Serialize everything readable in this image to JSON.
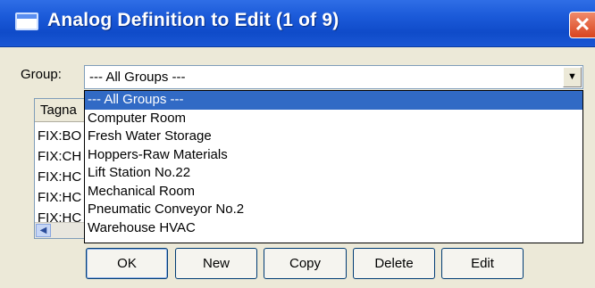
{
  "window": {
    "title": "Analog Definition to Edit (1 of 9)",
    "close_glyph": "✕"
  },
  "group": {
    "label": "Group:",
    "selected": "--- All Groups ---",
    "options": [
      "--- All Groups ---",
      "Computer Room",
      "Fresh Water Storage",
      "Hoppers-Raw Materials",
      "Lift Station No.22",
      "Mechanical Room",
      "Pneumatic Conveyor No.2",
      "Warehouse HVAC"
    ],
    "dropdown_arrow": "▼"
  },
  "list": {
    "header": "Tagna",
    "rows": [
      "FIX:BO",
      "FIX:CH",
      "FIX:HC",
      "FIX:HC",
      "FIX:HC"
    ],
    "scroll_left_glyph": "◀"
  },
  "buttons": {
    "ok": "OK",
    "new": "New",
    "copy": "Copy",
    "delete": "Delete",
    "edit": "Edit"
  }
}
